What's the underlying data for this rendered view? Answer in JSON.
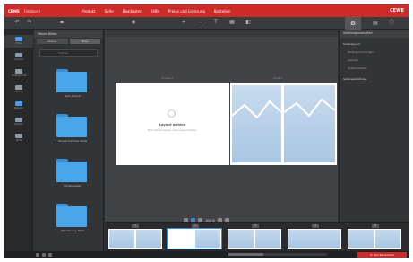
{
  "topbar": {
    "logo": "CEWE",
    "app_name": "Fotobuch",
    "menu": [
      "Produkt",
      "Seite",
      "Bearbeiten",
      "Hilfe",
      "Preise und Lieferung",
      "Bestellen"
    ],
    "brand_right": "CEWE"
  },
  "toolbar": {
    "tools": [
      "undo-icon",
      "redo-icon",
      "save-icon",
      "preview-icon",
      "add-page-icon",
      "remove-page-icon",
      "text-icon",
      "layout-icon",
      "background-icon"
    ]
  },
  "rail": {
    "items": [
      {
        "label": "Fotos"
      },
      {
        "label": "Layouts"
      },
      {
        "label": "Hintergründe"
      },
      {
        "label": "Cliparts"
      },
      {
        "label": "Rahmen"
      },
      {
        "label": "Masken"
      },
      {
        "label": "Texte"
      }
    ]
  },
  "library": {
    "title": "Meine Bilder",
    "tabs": [
      "Ordner",
      "Bilder"
    ],
    "search_placeholder": "Suchen",
    "folders": [
      "Mein Ordner",
      "Urlaub Sommer 2016",
      "Familienfeier",
      "Wanderung 2017"
    ]
  },
  "canvas": {
    "left_label": "Einband",
    "right_label": "Seite 1",
    "empty_title": "Layout wählen",
    "empty_subtitle": "Bild hierher ziehen oder Layout wählen",
    "zoom_text": "100 %"
  },
  "props": {
    "title": "Seiteneigenschaften",
    "rows": [
      {
        "label": "Seitenlayout",
        "kind": "section"
      },
      {
        "label": "Hintergrund ändern",
        "kind": "sub"
      },
      {
        "label": "Layouts",
        "kind": "sub"
      },
      {
        "label": "Seitenrahmen",
        "kind": "sub"
      },
      {
        "label": "Seitengestaltung",
        "kind": "section"
      }
    ]
  },
  "filmstrip": {
    "pages": [
      "1",
      "2",
      "3",
      "4",
      "5",
      "6"
    ]
  },
  "status": {
    "order_label": "In den Warenkorb",
    "progress": 0.35
  },
  "colors": {
    "brand": "#cf2a2a",
    "accent": "#3a8fd4",
    "folder": "#4aa6ea",
    "photo_sky": "#a9c6e3"
  }
}
